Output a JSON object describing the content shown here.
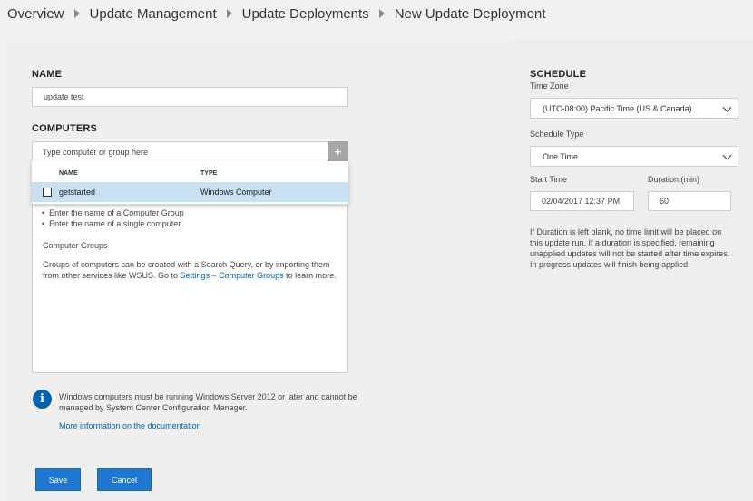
{
  "breadcrumb": {
    "items": [
      "Overview",
      "Update Management",
      "Update Deployments",
      "New Update Deployment"
    ]
  },
  "name_section": {
    "title": "NAME",
    "value": "update test"
  },
  "computers_section": {
    "title": "COMPUTERS",
    "search_placeholder": "Type computer or group here",
    "add_icon": "plus-icon",
    "dropdown": {
      "col_name": "NAME",
      "col_type": "TYPE",
      "rows": [
        {
          "name": "getstarted",
          "type": "Windows Computer",
          "checked": false
        }
      ]
    },
    "hints": [
      "Enter the name of a Computer Group",
      "Enter the name of a single computer"
    ],
    "groups_title": "Computer Groups",
    "groups_text_1": "Groups of computers can be created with a Search Query, or by importing them",
    "groups_text_2a": "from other services like WSUS. Go to ",
    "groups_link": "Settings – Computer Groups",
    "groups_text_2b": " to learn more."
  },
  "info": {
    "icon": "info-icon",
    "line1": "Windows computers must be running Windows Server 2012 or later and cannot be",
    "line2": "managed by System Center Configuration Manager.",
    "link": "More information on the documentation"
  },
  "buttons": {
    "save": "Save",
    "cancel": "Cancel"
  },
  "schedule": {
    "title": "SCHEDULE",
    "timezone_label": "Time Zone",
    "timezone_value": "(UTC-08:00) Pacific Time (US & Canada)",
    "type_label": "Schedule Type",
    "type_value": "One Time",
    "start_label": "Start Time",
    "start_value": "02/04/2017 12:37 PM",
    "duration_label": "Duration (min)",
    "duration_value": "60",
    "note": [
      "If Duration is left blank, no time limit will be placed on",
      "this update run. If a duration is specified, remaining",
      "unapplied updates will not be started after time expires.",
      "In progress updates will finish being applied."
    ]
  },
  "colors": {
    "accent": "#0063b1",
    "button": "#1e78d2",
    "selected_row": "#c7e0f4"
  }
}
